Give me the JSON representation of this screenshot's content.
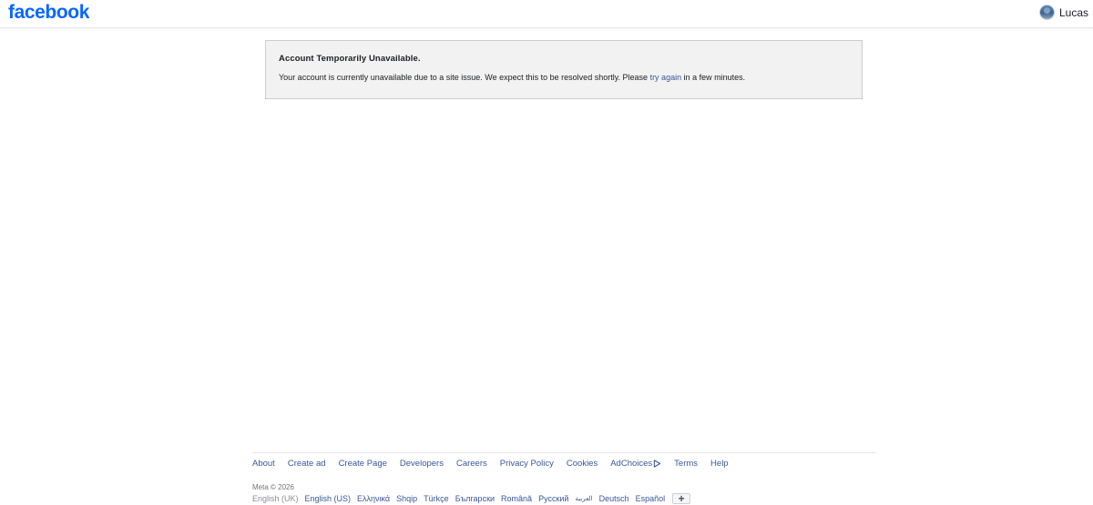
{
  "header": {
    "logo": "facebook",
    "user_name": "Lucas"
  },
  "notice": {
    "title": "Account Temporarily Unavailable.",
    "body_before": "Your account is currently unavailable due to a site issue. We expect this to be resolved shortly. Please ",
    "link_text": "try again",
    "body_after": " in a few minutes."
  },
  "footer": {
    "links": [
      "About",
      "Create ad",
      "Create Page",
      "Developers",
      "Careers",
      "Privacy Policy",
      "Cookies",
      "AdChoices",
      "Terms",
      "Help"
    ],
    "copyright": "Meta © 2026",
    "current_language": "English (UK)",
    "languages": [
      "English (US)",
      "Ελληνικά",
      "Shqip",
      "Türkçe",
      "Български",
      "Română",
      "Русский",
      "العربية",
      "Deutsch",
      "Español"
    ],
    "more_languages_label": "+"
  },
  "colors": {
    "brand": "#0866ff",
    "link": "#385898",
    "notice_bg": "#f2f2f2",
    "notice_border": "#cccccc"
  },
  "icons": {
    "adchoices": "adchoices-icon",
    "avatar": "avatar"
  }
}
